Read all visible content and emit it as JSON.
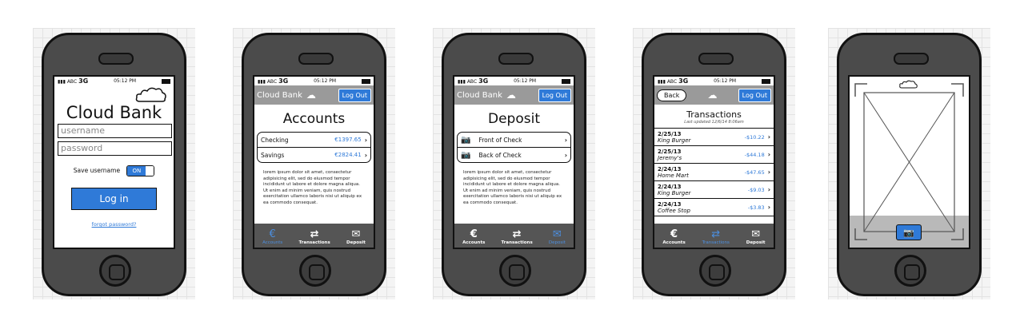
{
  "status": {
    "carrier": "ABC",
    "network": "3G",
    "time": "05:12 PM"
  },
  "app": {
    "bank_name": "Cloud Bank",
    "logout_label": "Log Out",
    "back_label": "Back"
  },
  "login": {
    "title": "Cloud Bank",
    "username_placeholder": "username",
    "password_placeholder": "password",
    "save_label": "Save username",
    "toggle_label": "ON",
    "login_label": "Log in",
    "forgot_label": "forgot password?"
  },
  "accounts": {
    "title": "Accounts",
    "items": [
      {
        "name": "Checking",
        "amount": "€1397.65"
      },
      {
        "name": "Savings",
        "amount": "€2824.41"
      }
    ]
  },
  "deposit": {
    "title": "Deposit",
    "items": [
      {
        "label": "Front of Check"
      },
      {
        "label": "Back of Check"
      }
    ]
  },
  "lorem": "lorem ipsum dolor sit amet, consectetur adipisicing elit, sed do eiusmod tempor incididunt ut labore et dolore magna aliqua. Ut enim ad minim veniam, quis nostrud exercitation ullamco laboris nisi ut aliquip ex ea commodo consequat.",
  "transactions": {
    "title": "Transactions",
    "subtitle": "Last updated 12/6/14 8:06am",
    "items": [
      {
        "date": "2/25/13",
        "name": "King Burger",
        "amount": "-$10.22"
      },
      {
        "date": "2/25/13",
        "name": "Jeremy's",
        "amount": "-$44.18"
      },
      {
        "date": "2/24/13",
        "name": "Home Mart",
        "amount": "-$47.65"
      },
      {
        "date": "2/24/13",
        "name": "King Burger",
        "amount": "-$9.03"
      },
      {
        "date": "2/24/13",
        "name": "Coffee Stop",
        "amount": "-$3.83"
      }
    ]
  },
  "tabs": {
    "accounts": "Accounts",
    "transactions": "Transactions",
    "deposit": "Deposit"
  },
  "icons": {
    "cloud": "cloud-icon",
    "camera": "camera-icon",
    "euro": "euro-icon",
    "refresh": "transactions-icon",
    "mail": "deposit-icon"
  },
  "colors": {
    "accent": "#2f7ad8",
    "navbar": "#9a9a9a",
    "tabbar": "#555555",
    "phone": "#4b4b4b"
  }
}
